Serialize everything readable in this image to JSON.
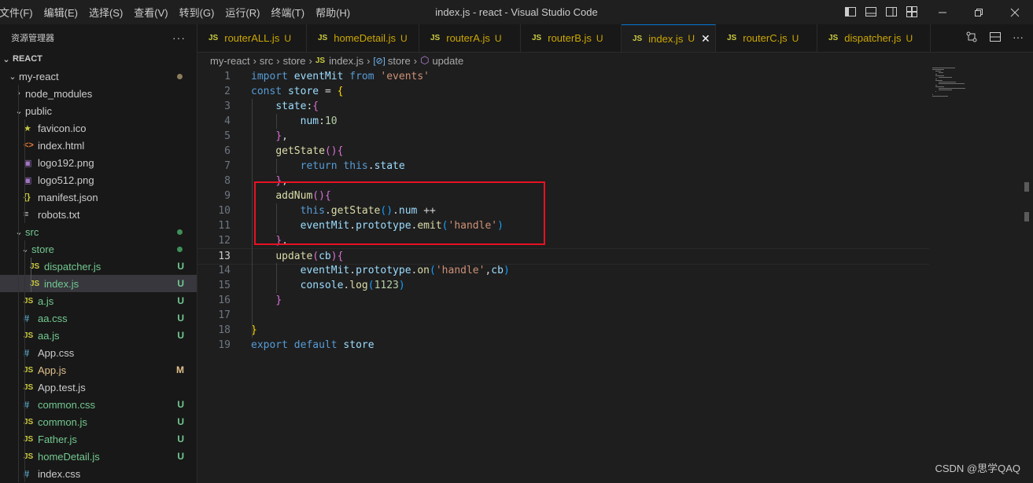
{
  "titlebar": {
    "title": "index.js - react - Visual Studio Code",
    "menu": [
      "文件(F)",
      "编辑(E)",
      "选择(S)",
      "查看(V)",
      "转到(G)",
      "运行(R)",
      "终端(T)",
      "帮助(H)"
    ]
  },
  "sidebar": {
    "header": "资源管理器",
    "more": "···",
    "section": "REACT",
    "items": [
      {
        "label": "my-react",
        "kind": "folder",
        "open": true,
        "depth": 0,
        "status": "dot"
      },
      {
        "label": "node_modules",
        "kind": "folder",
        "open": false,
        "depth": 1,
        "status": ""
      },
      {
        "label": "public",
        "kind": "folder",
        "open": true,
        "depth": 1,
        "status": ""
      },
      {
        "label": "favicon.ico",
        "kind": "star",
        "depth": 2,
        "status": ""
      },
      {
        "label": "index.html",
        "kind": "html",
        "depth": 2,
        "status": ""
      },
      {
        "label": "logo192.png",
        "kind": "img",
        "depth": 2,
        "status": ""
      },
      {
        "label": "logo512.png",
        "kind": "img",
        "depth": 2,
        "status": ""
      },
      {
        "label": "manifest.json",
        "kind": "json",
        "depth": 2,
        "status": ""
      },
      {
        "label": "robots.txt",
        "kind": "txt",
        "depth": 2,
        "status": ""
      },
      {
        "label": "src",
        "kind": "folder",
        "open": true,
        "depth": 1,
        "status": "greendot",
        "color": "green"
      },
      {
        "label": "store",
        "kind": "folder",
        "open": true,
        "depth": 2,
        "status": "greendot",
        "color": "green"
      },
      {
        "label": "dispatcher.js",
        "kind": "js",
        "depth": 3,
        "status": "U",
        "color": "green"
      },
      {
        "label": "index.js",
        "kind": "js",
        "depth": 3,
        "status": "U",
        "color": "green",
        "selected": true
      },
      {
        "label": "a.js",
        "kind": "js",
        "depth": 2,
        "status": "U",
        "color": "green"
      },
      {
        "label": "aa.css",
        "kind": "css",
        "depth": 2,
        "status": "U",
        "color": "green"
      },
      {
        "label": "aa.js",
        "kind": "js",
        "depth": 2,
        "status": "U",
        "color": "green"
      },
      {
        "label": "App.css",
        "kind": "css",
        "depth": 2,
        "status": ""
      },
      {
        "label": "App.js",
        "kind": "js",
        "depth": 2,
        "status": "M",
        "color": "amber"
      },
      {
        "label": "App.test.js",
        "kind": "js",
        "depth": 2,
        "status": ""
      },
      {
        "label": "common.css",
        "kind": "css",
        "depth": 2,
        "status": "U",
        "color": "green"
      },
      {
        "label": "common.js",
        "kind": "js",
        "depth": 2,
        "status": "U",
        "color": "green"
      },
      {
        "label": "Father.js",
        "kind": "js",
        "depth": 2,
        "status": "U",
        "color": "green"
      },
      {
        "label": "homeDetail.js",
        "kind": "js",
        "depth": 2,
        "status": "U",
        "color": "green"
      },
      {
        "label": "index.css",
        "kind": "css",
        "depth": 2,
        "status": ""
      }
    ]
  },
  "tabs": [
    {
      "label": "routerALL.js",
      "badge": "U",
      "active": false
    },
    {
      "label": "homeDetail.js",
      "badge": "U",
      "active": false
    },
    {
      "label": "routerA.js",
      "badge": "U",
      "active": false
    },
    {
      "label": "routerB.js",
      "badge": "U",
      "active": false
    },
    {
      "label": "index.js",
      "badge": "U",
      "active": true
    },
    {
      "label": "routerC.js",
      "badge": "U",
      "active": false
    },
    {
      "label": "dispatcher.js",
      "badge": "U",
      "active": false
    }
  ],
  "breadcrumb": [
    "my-react",
    "src",
    "store",
    "index.js",
    "store",
    "update"
  ],
  "editor": {
    "current_line": 13,
    "lines": [
      [
        [
          "kw",
          "import "
        ],
        [
          "var",
          "eventMit "
        ],
        [
          "kw",
          "from "
        ],
        [
          "str",
          "'events'"
        ]
      ],
      [
        [
          "kw",
          "const "
        ],
        [
          "var",
          "store "
        ],
        [
          "pl",
          "= "
        ],
        [
          "b1",
          "{"
        ]
      ],
      [
        [
          "pl",
          "    "
        ],
        [
          "var",
          "state"
        ],
        [
          "pl",
          ":"
        ],
        [
          "b2",
          "{"
        ]
      ],
      [
        [
          "pl",
          "        "
        ],
        [
          "var",
          "num"
        ],
        [
          "pl",
          ":"
        ],
        [
          "num",
          "10"
        ]
      ],
      [
        [
          "pl",
          "    "
        ],
        [
          "b2",
          "}"
        ],
        [
          "pl",
          ","
        ]
      ],
      [
        [
          "pl",
          "    "
        ],
        [
          "fn",
          "getState"
        ],
        [
          "b2",
          "()"
        ],
        [
          "b2",
          "{"
        ]
      ],
      [
        [
          "pl",
          "        "
        ],
        [
          "kw",
          "return "
        ],
        [
          "kw",
          "this"
        ],
        [
          "pl",
          "."
        ],
        [
          "var",
          "state"
        ]
      ],
      [
        [
          "pl",
          "    "
        ],
        [
          "b2",
          "}"
        ],
        [
          "pl",
          ","
        ]
      ],
      [
        [
          "pl",
          "    "
        ],
        [
          "fn",
          "addNum"
        ],
        [
          "b2",
          "()"
        ],
        [
          "b2",
          "{"
        ]
      ],
      [
        [
          "pl",
          "        "
        ],
        [
          "kw",
          "this"
        ],
        [
          "pl",
          "."
        ],
        [
          "fn",
          "getState"
        ],
        [
          "b3",
          "()"
        ],
        [
          "pl",
          "."
        ],
        [
          "var",
          "num "
        ],
        [
          "pl",
          "++"
        ]
      ],
      [
        [
          "pl",
          "        "
        ],
        [
          "var",
          "eventMit"
        ],
        [
          "pl",
          "."
        ],
        [
          "var",
          "prototype"
        ],
        [
          "pl",
          "."
        ],
        [
          "fn",
          "emit"
        ],
        [
          "b3",
          "("
        ],
        [
          "str",
          "'handle'"
        ],
        [
          "b3",
          ")"
        ]
      ],
      [
        [
          "pl",
          "    "
        ],
        [
          "b2",
          "}"
        ],
        [
          "pl",
          ","
        ]
      ],
      [
        [
          "pl",
          "    "
        ],
        [
          "fn",
          "update"
        ],
        [
          "b2",
          "("
        ],
        [
          "var",
          "cb"
        ],
        [
          "b2",
          ")"
        ],
        [
          "b2",
          "{"
        ]
      ],
      [
        [
          "pl",
          "        "
        ],
        [
          "var",
          "eventMit"
        ],
        [
          "pl",
          "."
        ],
        [
          "var",
          "prototype"
        ],
        [
          "pl",
          "."
        ],
        [
          "fn",
          "on"
        ],
        [
          "b3",
          "("
        ],
        [
          "str",
          "'handle'"
        ],
        [
          "pl",
          ","
        ],
        [
          "var",
          "cb"
        ],
        [
          "b3",
          ")"
        ]
      ],
      [
        [
          "pl",
          "        "
        ],
        [
          "var",
          "console"
        ],
        [
          "pl",
          "."
        ],
        [
          "fn",
          "log"
        ],
        [
          "b3",
          "("
        ],
        [
          "num",
          "1123"
        ],
        [
          "b3",
          ")"
        ]
      ],
      [
        [
          "pl",
          "    "
        ],
        [
          "b2",
          "}"
        ]
      ],
      [],
      [
        [
          "b1",
          "}"
        ]
      ],
      [
        [
          "kw",
          "export "
        ],
        [
          "kw",
          "default "
        ],
        [
          "var",
          "store"
        ]
      ]
    ]
  },
  "watermark": "CSDN @思学QAQ",
  "icons": {
    "layout": [
      "layout-sidebar-left-icon",
      "layout-panel-icon",
      "layout-sidebar-right-icon",
      "customize-layout-icon"
    ],
    "window": [
      "minimize-icon",
      "restore-icon",
      "close-icon"
    ],
    "tab_actions": [
      "compare-changes-icon",
      "split-editor-icon",
      "more-actions-icon"
    ]
  }
}
